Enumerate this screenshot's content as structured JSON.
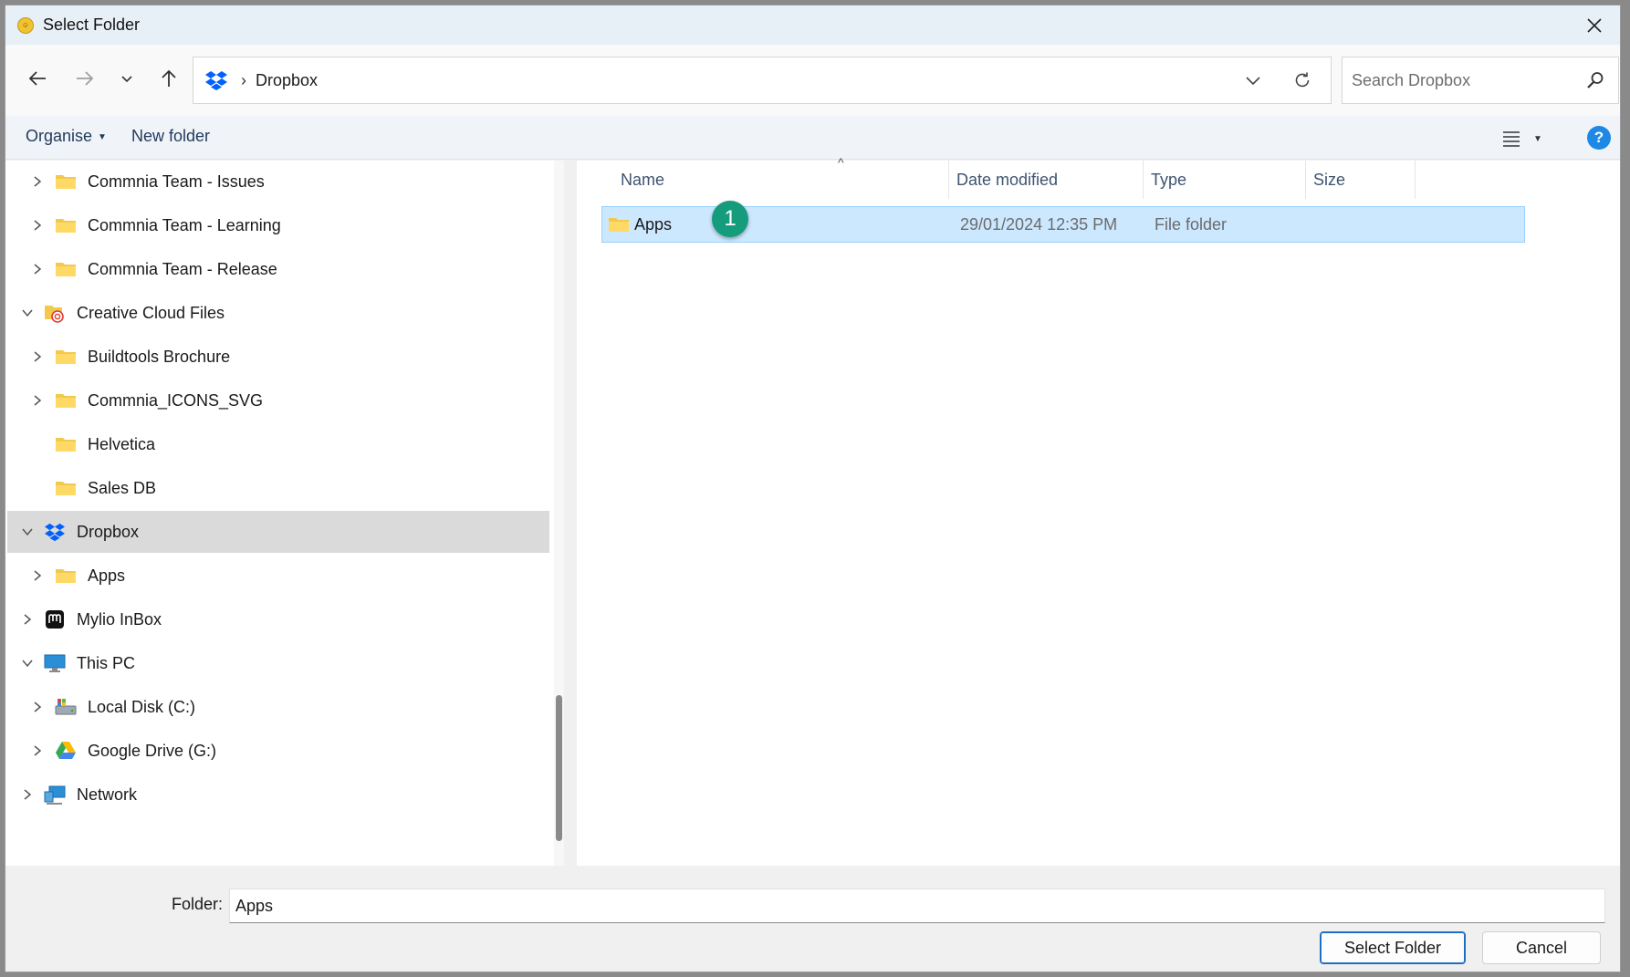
{
  "window": {
    "title": "Select Folder",
    "app_icon": "app-icon"
  },
  "address_bar": {
    "location_icon": "dropbox-icon",
    "separator": "›",
    "crumb": "Dropbox"
  },
  "search": {
    "placeholder": "Search Dropbox"
  },
  "command_bar": {
    "organise_label": "Organise",
    "new_folder_label": "New folder"
  },
  "tree": {
    "items": [
      {
        "label": "Commnia Team - Issues",
        "icon": "folder-icon",
        "expander": "collapsed"
      },
      {
        "label": "Commnia Team - Learning",
        "icon": "folder-icon",
        "expander": "collapsed"
      },
      {
        "label": "Commnia Team - Release",
        "icon": "folder-icon",
        "expander": "collapsed"
      },
      {
        "label": "Creative Cloud Files",
        "icon": "creative-cloud-folder-icon",
        "expander": "expanded"
      },
      {
        "label": "Buildtools Brochure",
        "icon": "folder-icon",
        "expander": "collapsed"
      },
      {
        "label": "Commnia_ICONS_SVG",
        "icon": "folder-icon",
        "expander": "collapsed"
      },
      {
        "label": "Helvetica",
        "icon": "folder-icon",
        "expander": "none"
      },
      {
        "label": "Sales DB",
        "icon": "folder-icon",
        "expander": "none"
      },
      {
        "label": "Dropbox",
        "icon": "dropbox-icon",
        "expander": "expanded",
        "selected": true
      },
      {
        "label": "Apps",
        "icon": "folder-icon",
        "expander": "collapsed"
      },
      {
        "label": "Mylio InBox",
        "icon": "mylio-icon",
        "expander": "collapsed"
      },
      {
        "label": "This PC",
        "icon": "monitor-icon",
        "expander": "expanded"
      },
      {
        "label": "Local Disk (C:)",
        "icon": "drive-icon",
        "expander": "collapsed"
      },
      {
        "label": "Google Drive (G:)",
        "icon": "google-drive-icon",
        "expander": "collapsed"
      },
      {
        "label": "Network",
        "icon": "network-icon",
        "expander": "collapsed"
      }
    ]
  },
  "file_list": {
    "columns": [
      "Name",
      "Date modified",
      "Type",
      "Size"
    ],
    "rows": [
      {
        "name": "Apps",
        "date_modified": "29/01/2024 12:35 PM",
        "type": "File folder",
        "size": ""
      }
    ],
    "annotation_badge": "1"
  },
  "footer": {
    "folder_label": "Folder:",
    "folder_value": "Apps",
    "select_button": "Select Folder",
    "cancel_button": "Cancel"
  },
  "colors": {
    "selection_bg": "#cce8ff",
    "selection_border": "#99d1ff",
    "tree_selected": "#dadada",
    "badge": "#149c7c",
    "help": "#1e88e5",
    "dropbox_blue": "#0061fe"
  }
}
